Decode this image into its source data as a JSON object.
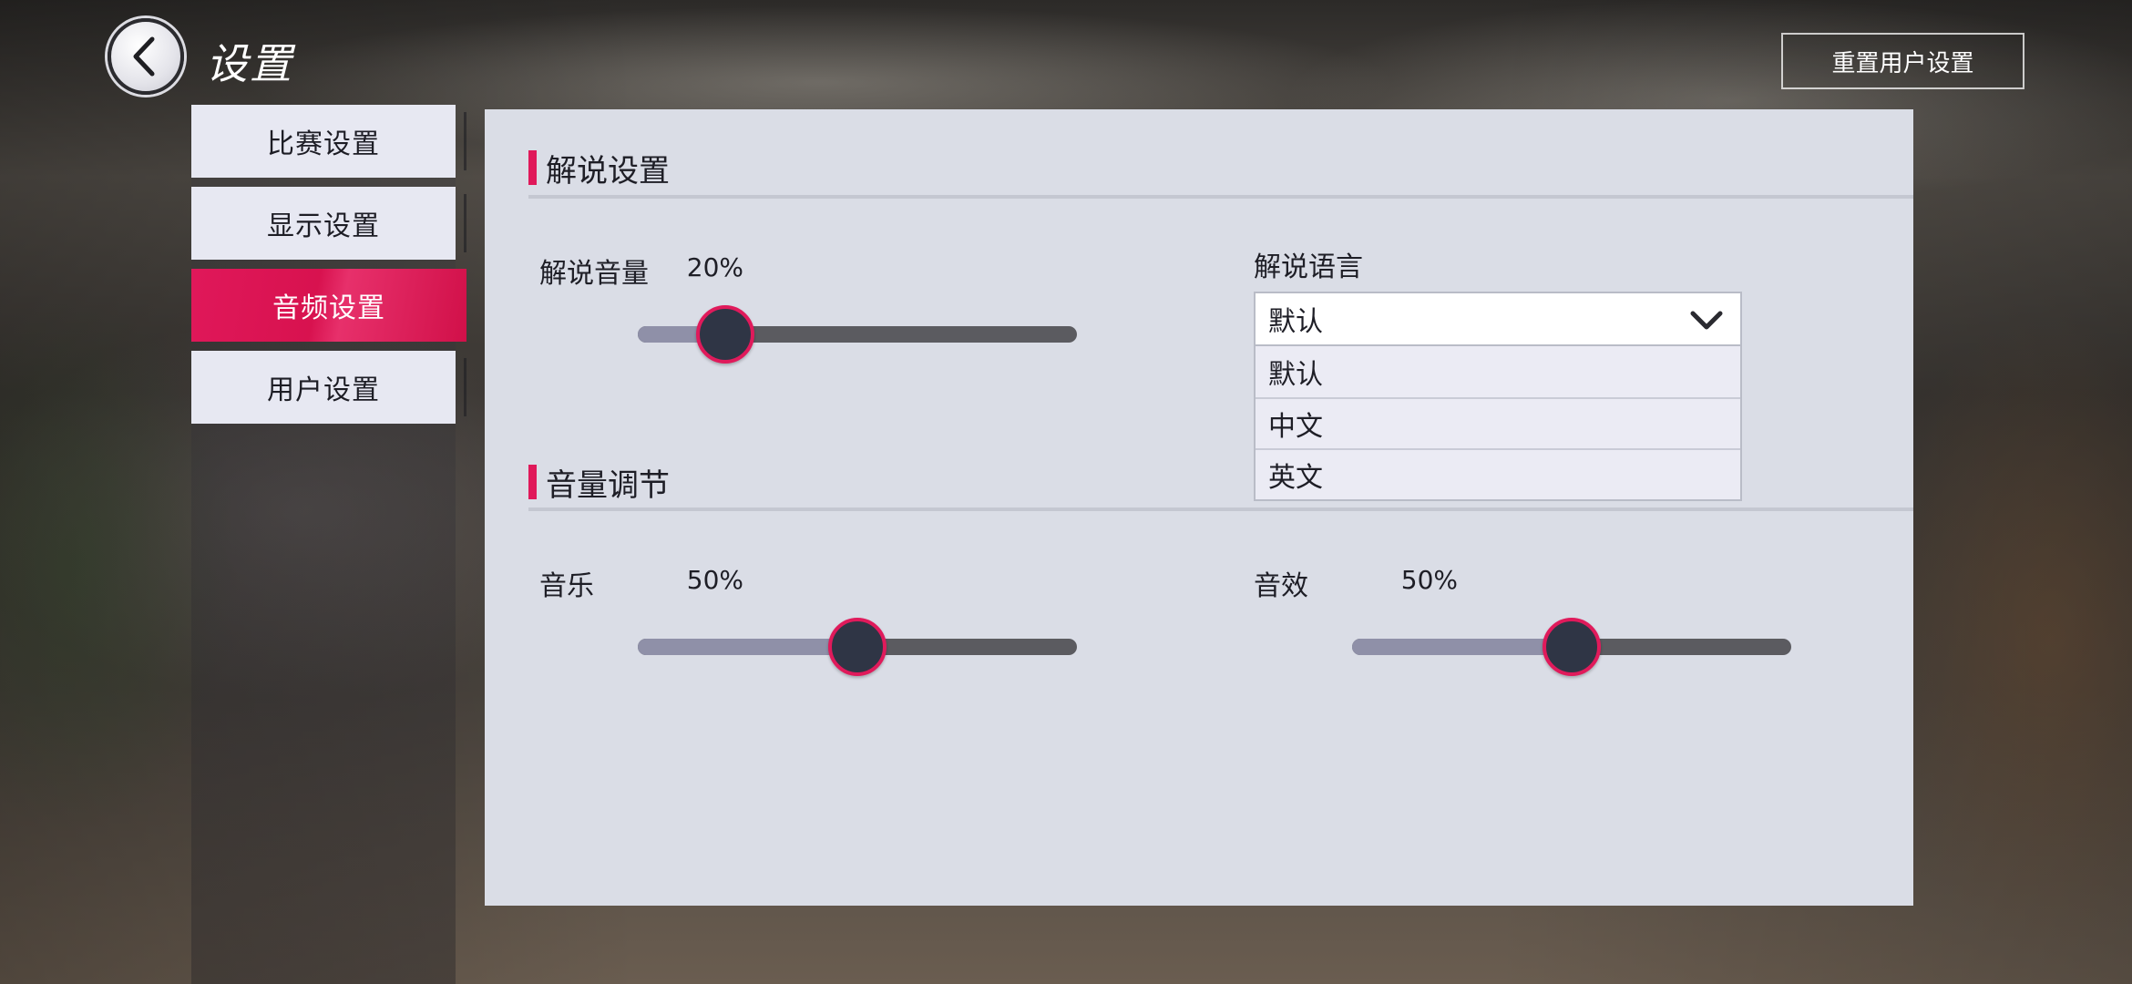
{
  "header": {
    "title": "设置",
    "reset_button": "重置用户设置"
  },
  "sidebar": {
    "items": [
      {
        "label": "比赛设置"
      },
      {
        "label": "显示设置"
      },
      {
        "label": "音频设置",
        "active": true
      },
      {
        "label": "用户设置"
      }
    ]
  },
  "commentary": {
    "section_title": "解说设置",
    "volume_label": "解说音量",
    "volume_value": "20%",
    "volume_level": 0.2,
    "language_label": "解说语言",
    "language_selected": "默认",
    "language_options": [
      "默认",
      "中文",
      "英文"
    ]
  },
  "volume": {
    "section_title": "音量调节",
    "music_label": "音乐",
    "music_value": "50%",
    "music_level": 0.5,
    "sfx_label": "音效",
    "sfx_value": "50%",
    "sfx_level": 0.5
  },
  "colors": {
    "accent": "#e0195a",
    "panel": "#dadde6",
    "slider_track": "#5b5b60",
    "slider_fill": "#8f90a8",
    "knob": "#2f3545"
  },
  "icons": {
    "back": "chevron-left-icon",
    "dropdown": "chevron-down-icon"
  }
}
